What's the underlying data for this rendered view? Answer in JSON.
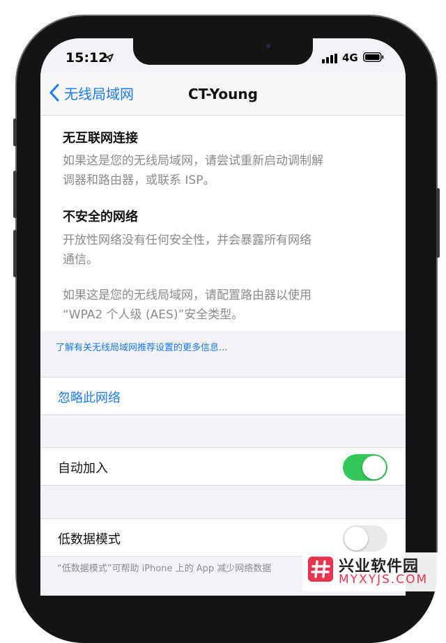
{
  "status_bar": {
    "time": "15:12",
    "network": "4G"
  },
  "nav": {
    "back_label": "无线局域网",
    "title": "CT-Young"
  },
  "warnings": {
    "no_internet_title": "无互联网连接",
    "no_internet_line1": "如果这是您的无线局域网，请尝试重新启动调制解",
    "no_internet_line2": "调器和路由器，或联系 ISP。",
    "insecure_title": "不安全的网络",
    "insecure_line1": "开放性网络没有任何安全性，并会暴露所有网络",
    "insecure_line2": "通信。",
    "config_line1": "如果这是您的无线局域网，请配置路由器以使用",
    "config_line2": "“WPA2 个人级 (AES)”安全类型。"
  },
  "learn_more": "了解有关无线局域网推荐设置的更多信息...",
  "forget_network": "忽略此网络",
  "auto_join": {
    "label": "自动加入",
    "enabled": true
  },
  "low_data_mode": {
    "label": "低数据模式",
    "enabled": false
  },
  "footnote": "“低数据模式”可帮助 iPhone 上的 App 减少网络数据",
  "watermark": {
    "name": "兴业软件园",
    "url": "MYXYJS.COM"
  },
  "colors": {
    "accent": "#1a7cf0",
    "toggle_on": "#34c759",
    "toggle_off": "#e9e9eb"
  }
}
